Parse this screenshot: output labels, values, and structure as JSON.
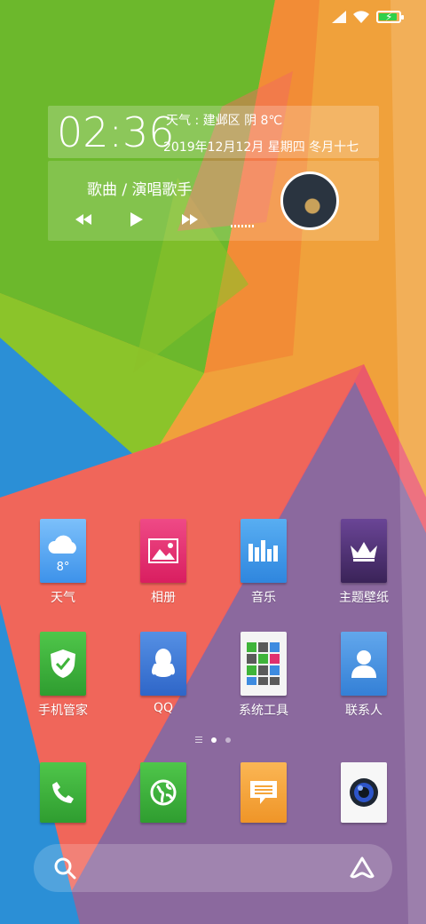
{
  "status_bar": {
    "icons": [
      "signal-icon",
      "wifi-icon",
      "battery-charging-icon"
    ],
    "battery_color": "#2fd04a"
  },
  "clock_widget": {
    "time": "02:36",
    "weather": "天气 : 建邺区  阴 8℃",
    "date": "2019年12月12月 星期四 冬月十七"
  },
  "music_widget": {
    "song": "歌曲 / 演唱歌手",
    "controls": [
      "previous-icon",
      "play-icon",
      "next-icon"
    ]
  },
  "apps_row1": [
    {
      "label": "天气",
      "icon": "weather-cloud-icon",
      "badge": "8°",
      "color": "#4fa3f5"
    },
    {
      "label": "相册",
      "icon": "gallery-icon",
      "color": "#e0306f"
    },
    {
      "label": "音乐",
      "icon": "music-equalizer-icon",
      "color": "#3b96e8"
    },
    {
      "label": "主题壁纸",
      "icon": "crown-icon",
      "color": "#4a2d6b"
    }
  ],
  "apps_row2": [
    {
      "label": "手机管家",
      "icon": "shield-icon",
      "color": "#3fb43a"
    },
    {
      "label": "QQ",
      "icon": "qq-penguin-icon",
      "color": "#3f79d6"
    },
    {
      "label": "系统工具",
      "icon": "tools-grid-icon",
      "color": "#f2f2f2"
    },
    {
      "label": "联系人",
      "icon": "contact-person-icon",
      "color": "#4a90dd"
    }
  ],
  "dock": [
    {
      "name": "phone",
      "icon": "phone-icon",
      "color": "#3fb43a"
    },
    {
      "name": "browser",
      "icon": "globe-icon",
      "color": "#3fb43a"
    },
    {
      "name": "messages",
      "icon": "message-icon",
      "color": "#f5a53a"
    },
    {
      "name": "camera",
      "icon": "camera-icon",
      "color": "#f2f2f2"
    }
  ],
  "page_indicator": {
    "pages": 2,
    "current": 1
  },
  "search_bar": {
    "left_icon": "search-icon",
    "right_icon": "assistant-icon"
  }
}
